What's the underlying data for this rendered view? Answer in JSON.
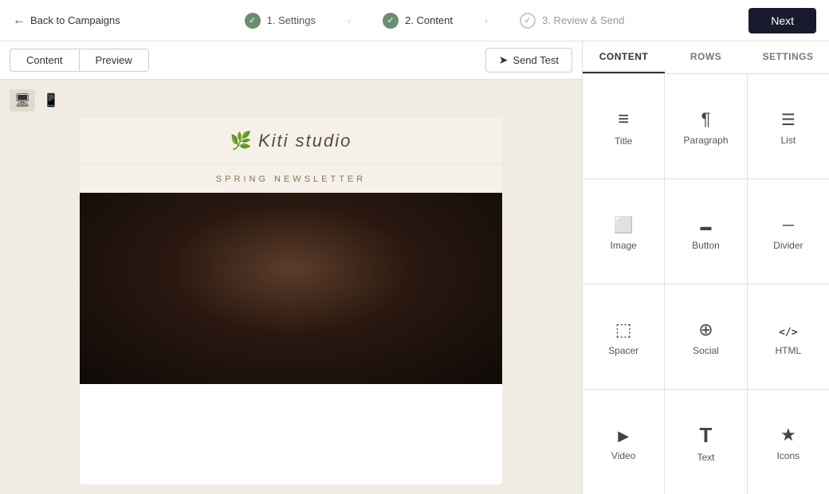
{
  "nav": {
    "back_label": "Back to Campaigns",
    "next_label": "Next",
    "steps": [
      {
        "id": "settings",
        "number": "1",
        "label": "Settings",
        "state": "completed"
      },
      {
        "id": "content",
        "number": "2",
        "label": "Content",
        "state": "active"
      },
      {
        "id": "review",
        "number": "3",
        "label": "Review & Send",
        "state": "pending"
      }
    ]
  },
  "view_tabs": {
    "content_label": "Content",
    "preview_label": "Preview",
    "send_test_label": "Send Test"
  },
  "device_toggle": {
    "desktop_label": "Desktop",
    "mobile_label": "Mobile"
  },
  "email_preview": {
    "logo_icon": "🌿",
    "logo_text": "Kiti studio",
    "banner_text": "SPRING NEWSLETTER"
  },
  "panel_tabs": {
    "content_label": "CONTENT",
    "rows_label": "ROWS",
    "settings_label": "SETTINGS"
  },
  "blocks": [
    {
      "id": "title",
      "label": "Title",
      "icon_class": "icon-title"
    },
    {
      "id": "paragraph",
      "label": "Paragraph",
      "icon_class": "icon-paragraph"
    },
    {
      "id": "list",
      "label": "List",
      "icon_class": "icon-list"
    },
    {
      "id": "image",
      "label": "Image",
      "icon_class": "icon-image"
    },
    {
      "id": "button",
      "label": "Button",
      "icon_class": "icon-button"
    },
    {
      "id": "divider",
      "label": "Divider",
      "icon_class": "icon-divider"
    },
    {
      "id": "spacer",
      "label": "Spacer",
      "icon_class": "icon-spacer"
    },
    {
      "id": "social",
      "label": "Social",
      "icon_class": "icon-social"
    },
    {
      "id": "html",
      "label": "HTML",
      "icon_class": "icon-html"
    },
    {
      "id": "video",
      "label": "Video",
      "icon_class": "icon-video"
    },
    {
      "id": "text",
      "label": "Text",
      "icon_class": "icon-text"
    },
    {
      "id": "icons",
      "label": "Icons",
      "icon_class": "icon-icons"
    }
  ]
}
